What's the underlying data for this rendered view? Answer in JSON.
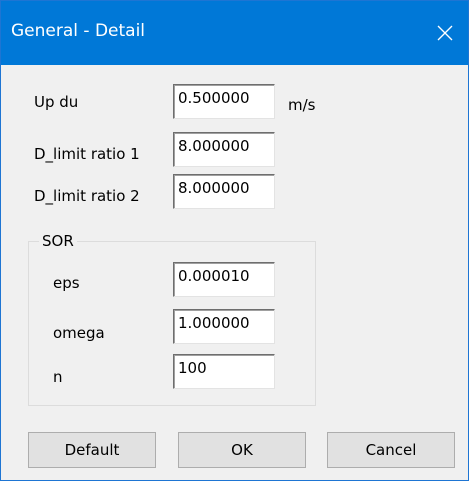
{
  "window": {
    "title": "General - Detail",
    "close_icon": "close-icon"
  },
  "fields": {
    "up_du": {
      "label": "Up du",
      "value": "0.500000",
      "unit": "m/s"
    },
    "d_limit_ratio_1": {
      "label": "D_limit ratio 1",
      "value": "8.000000"
    },
    "d_limit_ratio_2": {
      "label": "D_limit ratio 2",
      "value": "8.000000"
    }
  },
  "sor": {
    "title": "SOR",
    "eps": {
      "label": "eps",
      "value": "0.000010"
    },
    "omega": {
      "label": "omega",
      "value": "1.000000"
    },
    "n": {
      "label": "n",
      "value": "100"
    }
  },
  "buttons": {
    "default_label": "Default",
    "ok_label": "OK",
    "cancel_label": "Cancel"
  },
  "colors": {
    "title_bar": "#0078d7",
    "dialog_bg": "#f0f0f0",
    "button_bg": "#e1e1e1"
  }
}
